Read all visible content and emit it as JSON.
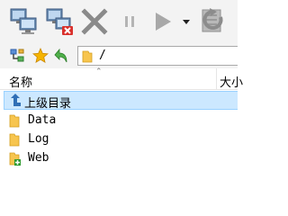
{
  "toolbar": {
    "buttons": [
      {
        "name": "connect-icon",
        "enabled": true
      },
      {
        "name": "disconnect-icon",
        "enabled": true
      },
      {
        "name": "cancel-icon",
        "enabled": false
      },
      {
        "name": "pause-icon",
        "enabled": false
      },
      {
        "name": "play-icon",
        "enabled": false
      },
      {
        "name": "dropdown-icon",
        "enabled": true
      },
      {
        "name": "refresh-icon",
        "enabled": false
      }
    ]
  },
  "address": {
    "path": "/"
  },
  "columns": {
    "name": "名称",
    "size": "大小"
  },
  "files": [
    {
      "label": "上级目录",
      "type": "parent",
      "mono": false
    },
    {
      "label": "Data",
      "type": "folder",
      "mono": true
    },
    {
      "label": "Log",
      "type": "folder",
      "mono": true
    },
    {
      "label": "Web",
      "type": "folder-new",
      "mono": true
    }
  ],
  "colors": {
    "selection": "#cce8ff",
    "folder": "#f7c54f",
    "toolbar_bg": "#f3f3f3"
  }
}
